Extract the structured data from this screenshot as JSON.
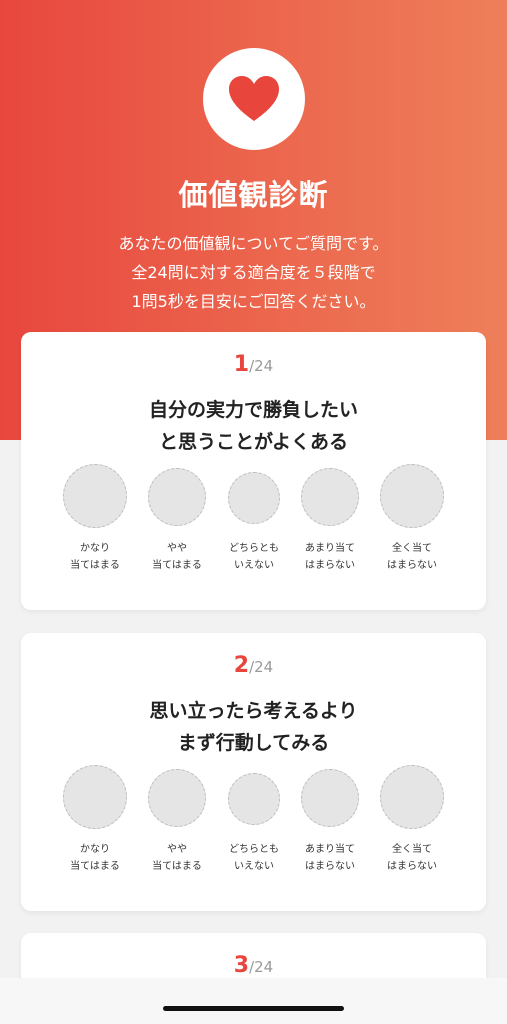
{
  "hero": {
    "title": "価値観診断",
    "desc": [
      "あなたの価値観についてご質問です。",
      "全24問に対する適合度を５段階で",
      "1問5秒を目安にご回答ください。"
    ]
  },
  "options": [
    [
      "かなり",
      "当てはまる"
    ],
    [
      "やや",
      "当てはまる"
    ],
    [
      "どちらとも",
      "いえない"
    ],
    [
      "あまり当て",
      "はまらない"
    ],
    [
      "全く当て",
      "はまらない"
    ]
  ],
  "questions": [
    {
      "number": "1",
      "total": "/24",
      "lines": [
        "自分の実力で勝負したい",
        "と思うことがよくある"
      ]
    },
    {
      "number": "2",
      "total": "/24",
      "lines": [
        "思い立ったら考えるより",
        "まず行動してみる"
      ]
    },
    {
      "number": "3",
      "total": "/24",
      "lines": []
    }
  ],
  "colors": {
    "accent": "#e8453c",
    "hero_start": "#e8473e",
    "hero_end": "#ee7f5a"
  },
  "icons": {
    "hero": "heart-icon"
  }
}
